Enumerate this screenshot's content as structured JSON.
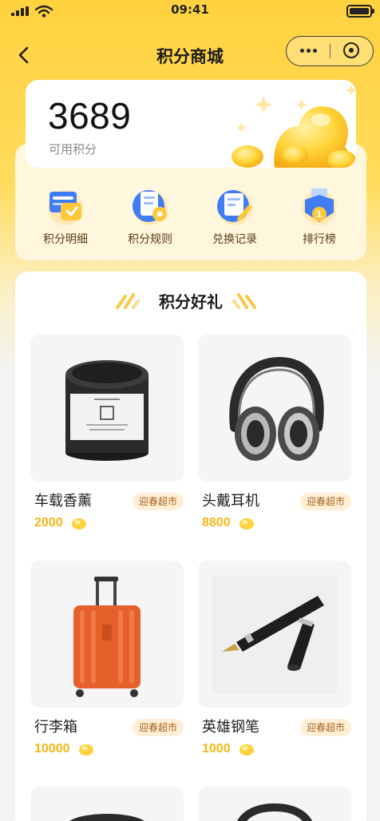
{
  "status_bar": {
    "time": "09:41"
  },
  "nav": {
    "title": "积分商城"
  },
  "points": {
    "value": "3689",
    "label": "可用积分"
  },
  "menu": [
    {
      "label": "积分明细",
      "icon": "points-detail-icon"
    },
    {
      "label": "积分规则",
      "icon": "points-rules-icon"
    },
    {
      "label": "兑换记录",
      "icon": "exchange-record-icon"
    },
    {
      "label": "排行榜",
      "icon": "ranking-icon"
    }
  ],
  "section": {
    "title": "积分好礼"
  },
  "products": [
    {
      "name": "车载香薰",
      "tag": "迎春超市",
      "price": "2000",
      "icon": "aromatherapy-jar-image"
    },
    {
      "name": "头戴耳机",
      "tag": "迎春超市",
      "price": "8800",
      "icon": "headphones-image"
    },
    {
      "name": "行李箱",
      "tag": "迎春超市",
      "price": "10000",
      "icon": "suitcase-image"
    },
    {
      "name": "英雄钢笔",
      "tag": "迎春超市",
      "price": "1000",
      "icon": "fountain-pen-image"
    }
  ],
  "colors": {
    "brand_yellow": "#FFD23E",
    "price": "#F7B516",
    "tag_bg": "#FFEFD6",
    "tag_text": "#A5631C"
  }
}
